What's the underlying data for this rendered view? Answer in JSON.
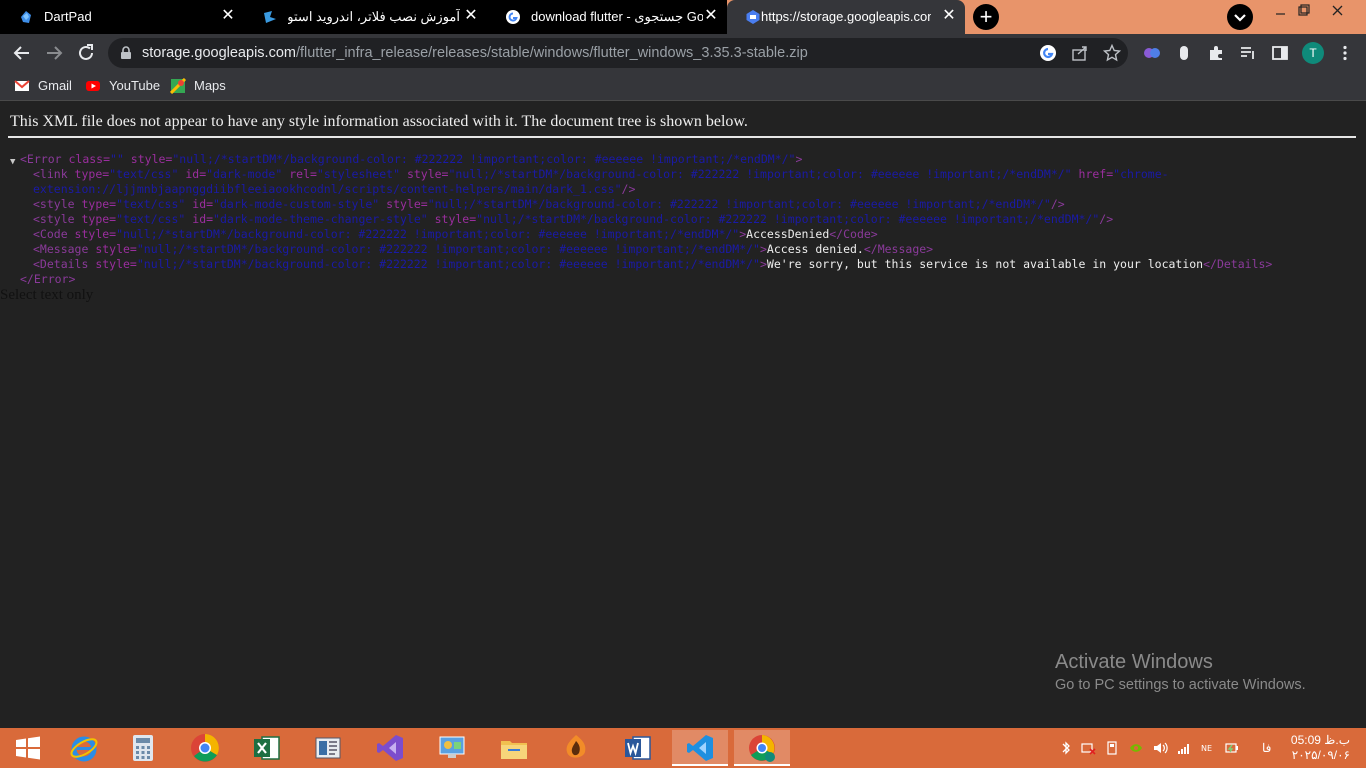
{
  "tabs": [
    {
      "title": "DartPad",
      "icon": "dartpad-icon",
      "active": false
    },
    {
      "title": "آموزش نصب فلاتر، اندروید استودیو",
      "icon": "cafe-bazaar-icon",
      "active": false
    },
    {
      "title": "download flutter - جستجوی Goog",
      "icon": "google-icon",
      "active": false
    },
    {
      "title": "https://storage.googleapis.com/f",
      "icon": "storage-icon",
      "active": true
    }
  ],
  "address_bar": {
    "host": "storage.googleapis.com",
    "path": "/flutter_infra_release/releases/stable/windows/flutter_windows_3.35.3-stable.zip"
  },
  "profile": {
    "initial": "T"
  },
  "bookmarks": [
    {
      "label": "Gmail",
      "icon": "gmail-icon"
    },
    {
      "label": "YouTube",
      "icon": "youtube-icon"
    },
    {
      "label": "Maps",
      "icon": "maps-icon"
    }
  ],
  "page": {
    "notice": "This XML file does not appear to have any style information associated with it. The document tree is shown below.",
    "xml": {
      "l1_open": "<Error",
      "l1_a1": " class=",
      "l1_v1": "\"\"",
      "l1_a2": " style=",
      "l1_v2": "\"null;/*startDM*/background-color: #222222 !important;color: #eeeeee !important;/*endDM*/\"",
      "l1_close": ">",
      "l2_open": "<link",
      "l2_a1": " type=",
      "l2_v1": "\"text/css\"",
      "l2_a2": " id=",
      "l2_v2": "\"dark-mode\"",
      "l2_a3": " rel=",
      "l2_v3": "\"stylesheet\"",
      "l2_a4": " style=",
      "l2_v4": "\"null;/*startDM*/background-color: #222222 !important;color: #eeeeee !important;/*endDM*/\"",
      "l2_a5": " href=",
      "l2_v5": "\"chrome-",
      "l2b_v5": "extension://ljjmnbjaapnggdiibfleeiaookhcodnl/scripts/content-helpers/main/dark_1.css\"",
      "l2b_close": "/>",
      "l3_open": "<style",
      "l3_a1": " type=",
      "l3_v1": "\"text/css\"",
      "l3_a2": " id=",
      "l3_v2": "\"dark-mode-custom-style\"",
      "l3_a3": " style=",
      "l3_v3": "\"null;/*startDM*/background-color: #222222 !important;color: #eeeeee !important;/*endDM*/\"",
      "l3_close": "/>",
      "l4_open": "<style",
      "l4_a1": " type=",
      "l4_v1": "\"text/css\"",
      "l4_a2": " id=",
      "l4_v2": "\"dark-mode-theme-changer-style\"",
      "l4_a3": " style=",
      "l4_v3": "\"null;/*startDM*/background-color: #222222 !important;color: #eeeeee !important;/*endDM*/\"",
      "l4_close": "/>",
      "l5_open": "<Code",
      "l5_a1": " style=",
      "l5_v1": "\"null;/*startDM*/background-color: #222222 !important;color: #eeeeee !important;/*endDM*/\"",
      "l5_gt": ">",
      "l5_text": "AccessDenied",
      "l5_end": "</Code>",
      "l6_open": "<Message",
      "l6_a1": " style=",
      "l6_v1": "\"null;/*startDM*/background-color: #222222 !important;color: #eeeeee !important;/*endDM*/\"",
      "l6_gt": ">",
      "l6_text": "Access denied.",
      "l6_end": "</Message>",
      "l7_open": "<Details",
      "l7_a1": " style=",
      "l7_v1": "\"null;/*startDM*/background-color: #222222 !important;color: #eeeeee !important;/*endDM*/\"",
      "l7_gt": ">",
      "l7_text": "We're sorry, but this service is not available in your location",
      "l7_end": "</Details>",
      "l8_end": "</Error>"
    },
    "select_text": "Select text only"
  },
  "watermark": {
    "title": "Activate Windows",
    "subtitle": "Go to PC settings to activate Windows."
  },
  "taskbar": {
    "apps": [
      "start-icon",
      "internet-explorer-icon",
      "calculator-icon",
      "chrome-icon",
      "excel-icon",
      "reader-icon",
      "visual-studio-icon",
      "control-panel-icon",
      "file-explorer-icon",
      "fl-studio-icon",
      "word-icon",
      "vscode-icon",
      "chrome-profile-icon"
    ],
    "language": "فا",
    "time": "05:09 ب.ظ",
    "date": "۲۰۲۵/۰۹/۰۶"
  },
  "colors": {
    "tab_strip": "#e8946a",
    "taskbar": "#d96a3a",
    "page_background": "#222222",
    "xml_tag": "#8a3a9a",
    "xml_value": "#1a1aa6"
  }
}
